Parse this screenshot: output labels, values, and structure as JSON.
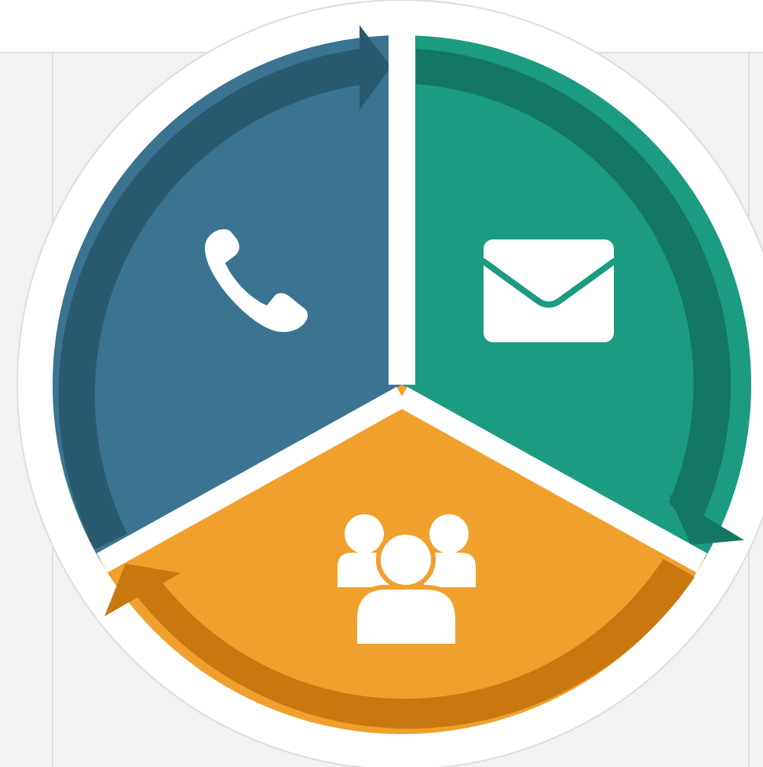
{
  "diagram": {
    "type": "three-segment-cycle",
    "direction": "clockwise",
    "segments": [
      {
        "key": "phone",
        "icon": "phone-icon",
        "fill": "#3a7491",
        "arrow": "#2a5a70"
      },
      {
        "key": "email",
        "icon": "envelope-icon",
        "fill": "#1b9b80",
        "arrow": "#147761"
      },
      {
        "key": "people",
        "icon": "group-icon",
        "fill": "#f0a02d",
        "arrow": "#c8780f"
      }
    ],
    "colors": {
      "ring": "#ffffff",
      "ring_border": "#dddddd",
      "icon": "#ffffff",
      "background_panel": "#f2f2f2",
      "page": "#ffffff"
    }
  }
}
